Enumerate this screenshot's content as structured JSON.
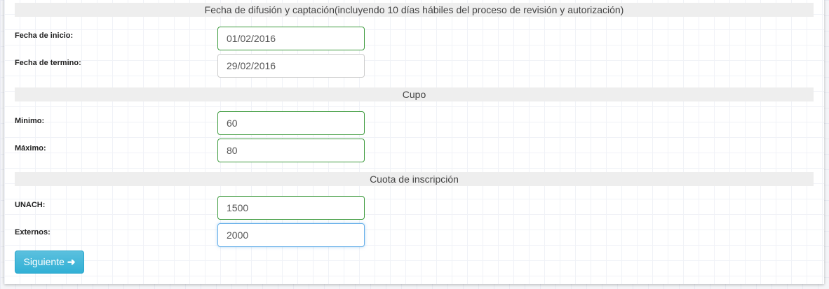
{
  "sections": [
    {
      "title": "Fecha de difusión y captación(incluyendo 10 días hábiles del proceso de revisión y autorización)",
      "fields": [
        {
          "label": "Fecha de inicio:",
          "value": "01/02/2016"
        },
        {
          "label": "Fecha de termino:",
          "value": "29/02/2016"
        }
      ]
    },
    {
      "title": "Cupo",
      "fields": [
        {
          "label": "Minimo:",
          "value": "60"
        },
        {
          "label": "Máximo:",
          "value": "80"
        }
      ]
    },
    {
      "title": "Cuota de inscripción",
      "fields": [
        {
          "label": "UNACH:",
          "value": "1500"
        },
        {
          "label": "Externos:",
          "value": "2000"
        }
      ]
    }
  ],
  "next_button": {
    "label": "Siguiente",
    "icon": "arrow-right-icon"
  }
}
